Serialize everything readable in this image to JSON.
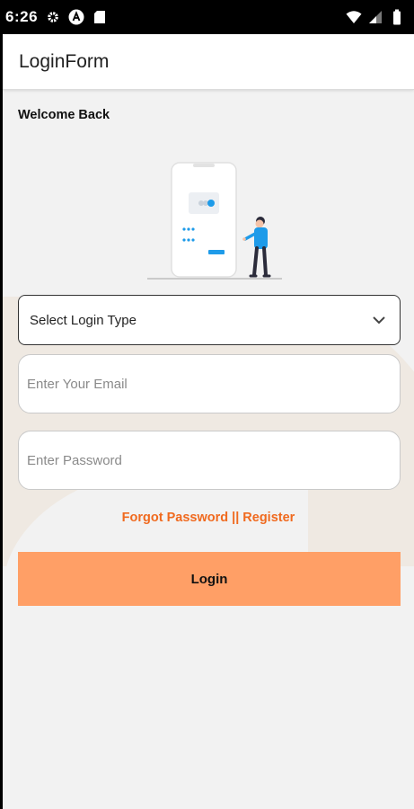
{
  "status_bar": {
    "time": "6:26",
    "left_icons": [
      "gear-icon",
      "a-badge-icon",
      "sd-card-icon"
    ],
    "right_icons": [
      "wifi-icon",
      "cellular-signal-icon",
      "battery-icon"
    ]
  },
  "app_bar": {
    "title": "LoginForm"
  },
  "welcome_text": "Welcome Back",
  "login_type_select": {
    "value": "Select Login Type"
  },
  "email_field": {
    "placeholder": "Enter Your Email",
    "value": ""
  },
  "password_field": {
    "placeholder": "Enter Password",
    "value": ""
  },
  "links": {
    "forgot_password": "Forgot Password",
    "separator": " || ",
    "register": "Register"
  },
  "login_button": {
    "label": "Login"
  },
  "colors": {
    "accent_orange": "#f06a1f",
    "button_orange": "#ff9f66",
    "illustration_blue": "#1e9be9"
  }
}
